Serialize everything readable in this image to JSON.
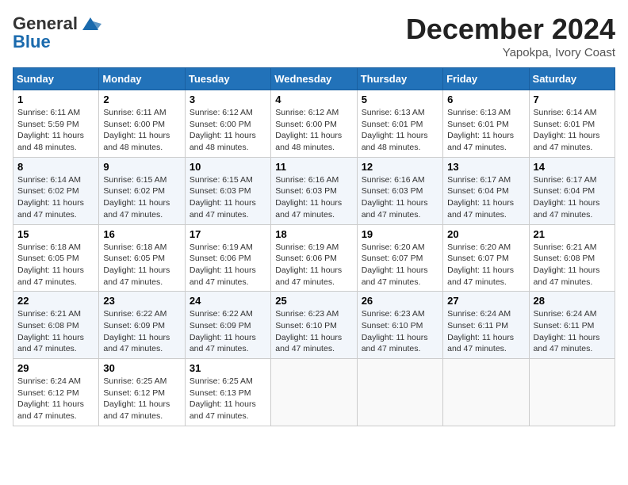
{
  "header": {
    "logo_general": "General",
    "logo_blue": "Blue",
    "month_title": "December 2024",
    "location": "Yapokpa, Ivory Coast"
  },
  "weekdays": [
    "Sunday",
    "Monday",
    "Tuesday",
    "Wednesday",
    "Thursday",
    "Friday",
    "Saturday"
  ],
  "weeks": [
    [
      {
        "day": "1",
        "lines": [
          "Sunrise: 6:11 AM",
          "Sunset: 5:59 PM",
          "Daylight: 11 hours",
          "and 48 minutes."
        ]
      },
      {
        "day": "2",
        "lines": [
          "Sunrise: 6:11 AM",
          "Sunset: 6:00 PM",
          "Daylight: 11 hours",
          "and 48 minutes."
        ]
      },
      {
        "day": "3",
        "lines": [
          "Sunrise: 6:12 AM",
          "Sunset: 6:00 PM",
          "Daylight: 11 hours",
          "and 48 minutes."
        ]
      },
      {
        "day": "4",
        "lines": [
          "Sunrise: 6:12 AM",
          "Sunset: 6:00 PM",
          "Daylight: 11 hours",
          "and 48 minutes."
        ]
      },
      {
        "day": "5",
        "lines": [
          "Sunrise: 6:13 AM",
          "Sunset: 6:01 PM",
          "Daylight: 11 hours",
          "and 48 minutes."
        ]
      },
      {
        "day": "6",
        "lines": [
          "Sunrise: 6:13 AM",
          "Sunset: 6:01 PM",
          "Daylight: 11 hours",
          "and 47 minutes."
        ]
      },
      {
        "day": "7",
        "lines": [
          "Sunrise: 6:14 AM",
          "Sunset: 6:01 PM",
          "Daylight: 11 hours",
          "and 47 minutes."
        ]
      }
    ],
    [
      {
        "day": "8",
        "lines": [
          "Sunrise: 6:14 AM",
          "Sunset: 6:02 PM",
          "Daylight: 11 hours",
          "and 47 minutes."
        ]
      },
      {
        "day": "9",
        "lines": [
          "Sunrise: 6:15 AM",
          "Sunset: 6:02 PM",
          "Daylight: 11 hours",
          "and 47 minutes."
        ]
      },
      {
        "day": "10",
        "lines": [
          "Sunrise: 6:15 AM",
          "Sunset: 6:03 PM",
          "Daylight: 11 hours",
          "and 47 minutes."
        ]
      },
      {
        "day": "11",
        "lines": [
          "Sunrise: 6:16 AM",
          "Sunset: 6:03 PM",
          "Daylight: 11 hours",
          "and 47 minutes."
        ]
      },
      {
        "day": "12",
        "lines": [
          "Sunrise: 6:16 AM",
          "Sunset: 6:03 PM",
          "Daylight: 11 hours",
          "and 47 minutes."
        ]
      },
      {
        "day": "13",
        "lines": [
          "Sunrise: 6:17 AM",
          "Sunset: 6:04 PM",
          "Daylight: 11 hours",
          "and 47 minutes."
        ]
      },
      {
        "day": "14",
        "lines": [
          "Sunrise: 6:17 AM",
          "Sunset: 6:04 PM",
          "Daylight: 11 hours",
          "and 47 minutes."
        ]
      }
    ],
    [
      {
        "day": "15",
        "lines": [
          "Sunrise: 6:18 AM",
          "Sunset: 6:05 PM",
          "Daylight: 11 hours",
          "and 47 minutes."
        ]
      },
      {
        "day": "16",
        "lines": [
          "Sunrise: 6:18 AM",
          "Sunset: 6:05 PM",
          "Daylight: 11 hours",
          "and 47 minutes."
        ]
      },
      {
        "day": "17",
        "lines": [
          "Sunrise: 6:19 AM",
          "Sunset: 6:06 PM",
          "Daylight: 11 hours",
          "and 47 minutes."
        ]
      },
      {
        "day": "18",
        "lines": [
          "Sunrise: 6:19 AM",
          "Sunset: 6:06 PM",
          "Daylight: 11 hours",
          "and 47 minutes."
        ]
      },
      {
        "day": "19",
        "lines": [
          "Sunrise: 6:20 AM",
          "Sunset: 6:07 PM",
          "Daylight: 11 hours",
          "and 47 minutes."
        ]
      },
      {
        "day": "20",
        "lines": [
          "Sunrise: 6:20 AM",
          "Sunset: 6:07 PM",
          "Daylight: 11 hours",
          "and 47 minutes."
        ]
      },
      {
        "day": "21",
        "lines": [
          "Sunrise: 6:21 AM",
          "Sunset: 6:08 PM",
          "Daylight: 11 hours",
          "and 47 minutes."
        ]
      }
    ],
    [
      {
        "day": "22",
        "lines": [
          "Sunrise: 6:21 AM",
          "Sunset: 6:08 PM",
          "Daylight: 11 hours",
          "and 47 minutes."
        ]
      },
      {
        "day": "23",
        "lines": [
          "Sunrise: 6:22 AM",
          "Sunset: 6:09 PM",
          "Daylight: 11 hours",
          "and 47 minutes."
        ]
      },
      {
        "day": "24",
        "lines": [
          "Sunrise: 6:22 AM",
          "Sunset: 6:09 PM",
          "Daylight: 11 hours",
          "and 47 minutes."
        ]
      },
      {
        "day": "25",
        "lines": [
          "Sunrise: 6:23 AM",
          "Sunset: 6:10 PM",
          "Daylight: 11 hours",
          "and 47 minutes."
        ]
      },
      {
        "day": "26",
        "lines": [
          "Sunrise: 6:23 AM",
          "Sunset: 6:10 PM",
          "Daylight: 11 hours",
          "and 47 minutes."
        ]
      },
      {
        "day": "27",
        "lines": [
          "Sunrise: 6:24 AM",
          "Sunset: 6:11 PM",
          "Daylight: 11 hours",
          "and 47 minutes."
        ]
      },
      {
        "day": "28",
        "lines": [
          "Sunrise: 6:24 AM",
          "Sunset: 6:11 PM",
          "Daylight: 11 hours",
          "and 47 minutes."
        ]
      }
    ],
    [
      {
        "day": "29",
        "lines": [
          "Sunrise: 6:24 AM",
          "Sunset: 6:12 PM",
          "Daylight: 11 hours",
          "and 47 minutes."
        ]
      },
      {
        "day": "30",
        "lines": [
          "Sunrise: 6:25 AM",
          "Sunset: 6:12 PM",
          "Daylight: 11 hours",
          "and 47 minutes."
        ]
      },
      {
        "day": "31",
        "lines": [
          "Sunrise: 6:25 AM",
          "Sunset: 6:13 PM",
          "Daylight: 11 hours",
          "and 47 minutes."
        ]
      },
      null,
      null,
      null,
      null
    ]
  ]
}
